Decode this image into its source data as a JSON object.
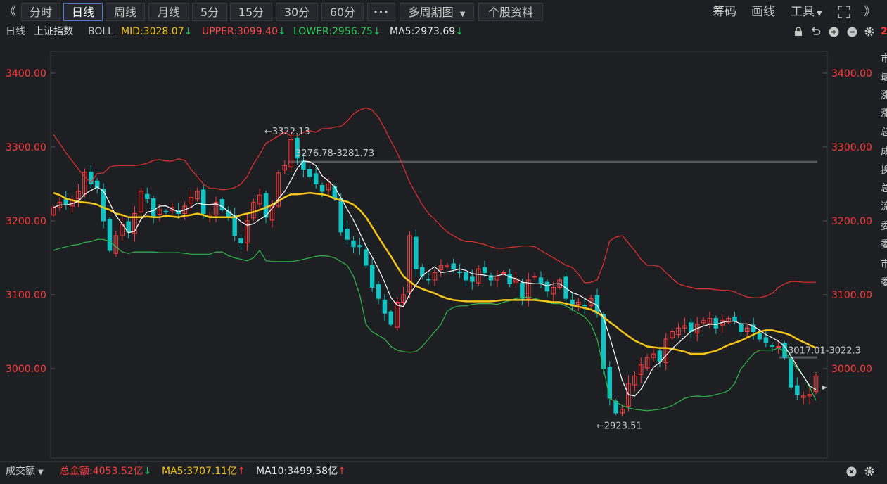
{
  "toolbar": {
    "collapse_glyph": "《",
    "expand_glyph": "》",
    "tabs": [
      "分时",
      "日线",
      "周线",
      "月线",
      "5分",
      "15分",
      "30分",
      "60分"
    ],
    "active_tab": "日线",
    "more_glyph": "•••",
    "multi_period": "多周期图",
    "profile": "个股资料",
    "right_items": [
      "筹码",
      "画线",
      "工具"
    ]
  },
  "info": {
    "period": "日线",
    "name": "上证指数",
    "indicator": "BOLL",
    "mid": "MID:3028.07",
    "upper": "UPPER:3099.40",
    "lower": "LOWER:2956.75",
    "ma5": "MA5:2973.69",
    "down_arrow": "↓",
    "up_arrow": "↑"
  },
  "right_strip": [
    "2",
    "市",
    "最",
    "涨",
    "涨",
    "总",
    "成",
    "换",
    "总",
    "流",
    "委",
    "委",
    "市",
    "委"
  ],
  "bottom": {
    "label": "成交额",
    "total": "总金额:4053.52亿",
    "ma5": "MA5:3707.11亿",
    "ma10": "MA10:3499.58亿"
  },
  "colors": {
    "up": "#ff3b3b",
    "down": "#13c2c2",
    "upper_band": "#e8302f",
    "lower_band": "#2fb84a",
    "mid_line": "#f5c518",
    "ma5_line": "#ffffff",
    "axis_text": "#ff3b3b",
    "background": "#1e1f23"
  },
  "chart_data": {
    "type": "candlestick",
    "y_ticks": [
      3400,
      3300,
      3200,
      3100,
      3000
    ],
    "y_tick_labels": [
      "3400.00",
      "3300.00",
      "3200.00",
      "3100.00",
      "3000.00"
    ],
    "ylim": [
      2900,
      3420
    ],
    "grid": false,
    "annotations": [
      {
        "text": "←3322.13",
        "value": 3322.13
      },
      {
        "text": "←2923.51",
        "value": 2923.51
      },
      {
        "text": "3276.78-3281.73",
        "low": 3276.78,
        "high": 3281.73
      },
      {
        "text": "3017.01-3022.3",
        "low": 3017.01,
        "high": 3022.3
      }
    ],
    "closes": [
      3218,
      3225,
      3222,
      3228,
      3240,
      3266,
      3250,
      3245,
      3200,
      3160,
      3180,
      3195,
      3185,
      3210,
      3240,
      3230,
      3205,
      3215,
      3212,
      3218,
      3210,
      3220,
      3232,
      3240,
      3210,
      3208,
      3225,
      3215,
      3205,
      3180,
      3170,
      3200,
      3225,
      3235,
      3205,
      3220,
      3265,
      3275,
      3310,
      3285,
      3270,
      3260,
      3250,
      3240,
      3250,
      3230,
      3185,
      3175,
      3165,
      3165,
      3140,
      3110,
      3095,
      3075,
      3060,
      3090,
      3100,
      3180,
      3135,
      3125,
      3120,
      3130,
      3140,
      3140,
      3135,
      3130,
      3120,
      3118,
      3135,
      3130,
      3120,
      3125,
      3130,
      3115,
      3120,
      3095,
      3120,
      3125,
      3115,
      3105,
      3110,
      3120,
      3095,
      3085,
      3090,
      3085,
      3095,
      3075,
      3000,
      2960,
      2940,
      2945,
      2980,
      2990,
      3005,
      3015,
      3020,
      3010,
      3040,
      3050,
      3055,
      3058,
      3050,
      3060,
      3065,
      3068,
      3055,
      3065,
      3068,
      3065,
      3050,
      3055,
      3050,
      3040,
      3035,
      3030,
      3030,
      3015,
      2975,
      2965,
      2963,
      2965,
      2990
    ],
    "upper_band": [
      3317,
      3305,
      3292,
      3281,
      3270,
      3260,
      3252,
      3264,
      3265,
      3273,
      3275,
      3275,
      3275,
      3275,
      3276,
      3278,
      3282,
      3283,
      3281,
      3281,
      3284,
      3282,
      3270,
      3260,
      3250,
      3244,
      3244,
      3242,
      3243,
      3245,
      3250,
      3260,
      3277,
      3290,
      3305,
      3310,
      3315,
      3320,
      3315,
      3315,
      3320,
      3322,
      3320,
      3325,
      3325,
      3327,
      3328,
      3335,
      3345,
      3350,
      3353,
      3350,
      3340,
      3325,
      3308,
      3292,
      3273,
      3252,
      3237,
      3222,
      3210,
      3202,
      3193,
      3185,
      3180,
      3175,
      3172,
      3172,
      3170,
      3168,
      3165,
      3163,
      3163,
      3164,
      3165,
      3166,
      3166,
      3165,
      3160,
      3155,
      3150,
      3145,
      3140,
      3137,
      3128,
      3116,
      3117,
      3120,
      3142,
      3173,
      3178,
      3180,
      3170,
      3160,
      3148,
      3140,
      3140,
      3138,
      3130,
      3122,
      3115,
      3112,
      3110,
      3108,
      3108,
      3108,
      3107,
      3106,
      3106,
      3104,
      3100,
      3097,
      3096,
      3096,
      3098,
      3102,
      3110,
      3115,
      3118,
      3118,
      3117,
      3117,
      3117
    ],
    "lower_band": [
      3160,
      3163,
      3165,
      3167,
      3168,
      3171,
      3172,
      3175,
      3175,
      3172,
      3165,
      3158,
      3156,
      3158,
      3158,
      3158,
      3158,
      3157,
      3157,
      3157,
      3157,
      3156,
      3155,
      3155,
      3155,
      3155,
      3158,
      3158,
      3153,
      3150,
      3148,
      3146,
      3150,
      3160,
      3146,
      3145,
      3145,
      3145,
      3145,
      3146,
      3148,
      3150,
      3152,
      3153,
      3152,
      3150,
      3145,
      3140,
      3125,
      3100,
      3060,
      3050,
      3045,
      3040,
      3030,
      3025,
      3023,
      3022,
      3023,
      3030,
      3040,
      3050,
      3060,
      3078,
      3083,
      3085,
      3085,
      3087,
      3088,
      3088,
      3088,
      3087,
      3090,
      3092,
      3095,
      3096,
      3097,
      3095,
      3093,
      3090,
      3088,
      3088,
      3085,
      3080,
      3075,
      3070,
      3060,
      3040,
      3000,
      2960,
      2955,
      2950,
      2947,
      2945,
      2944,
      2943,
      2944,
      2945,
      2947,
      2950,
      2955,
      2960,
      2962,
      2963,
      2962,
      2963,
      2965,
      2967,
      2970,
      2980,
      3000,
      3010,
      3020,
      3025,
      3025,
      3025,
      3028,
      3023,
      3012,
      3000,
      2990,
      2975,
      2957
    ],
    "mid_line": [
      3238,
      3235,
      3230,
      3228,
      3226,
      3225,
      3224,
      3222,
      3218,
      3215,
      3210,
      3208,
      3205,
      3205,
      3205,
      3206,
      3205,
      3205,
      3207,
      3206,
      3205,
      3207,
      3208,
      3210,
      3208,
      3205,
      3205,
      3205,
      3205,
      3205,
      3208,
      3210,
      3212,
      3215,
      3218,
      3222,
      3227,
      3232,
      3236,
      3236,
      3237,
      3238,
      3237,
      3236,
      3234,
      3230,
      3228,
      3226,
      3222,
      3215,
      3205,
      3192,
      3178,
      3165,
      3152,
      3138,
      3125,
      3118,
      3112,
      3108,
      3105,
      3102,
      3098,
      3095,
      3093,
      3092,
      3091,
      3091,
      3091,
      3091,
      3091,
      3092,
      3093,
      3093,
      3093,
      3093,
      3093,
      3093,
      3092,
      3091,
      3090,
      3090,
      3088,
      3086,
      3084,
      3082,
      3080,
      3076,
      3070,
      3063,
      3057,
      3050,
      3044,
      3038,
      3034,
      3030,
      3029,
      3028,
      3028,
      3027,
      3025,
      3023,
      3020,
      3020,
      3020,
      3022,
      3024,
      3028,
      3032,
      3035,
      3038,
      3042,
      3046,
      3050,
      3052,
      3052,
      3050,
      3048,
      3045,
      3040,
      3036,
      3032,
      3028
    ]
  }
}
